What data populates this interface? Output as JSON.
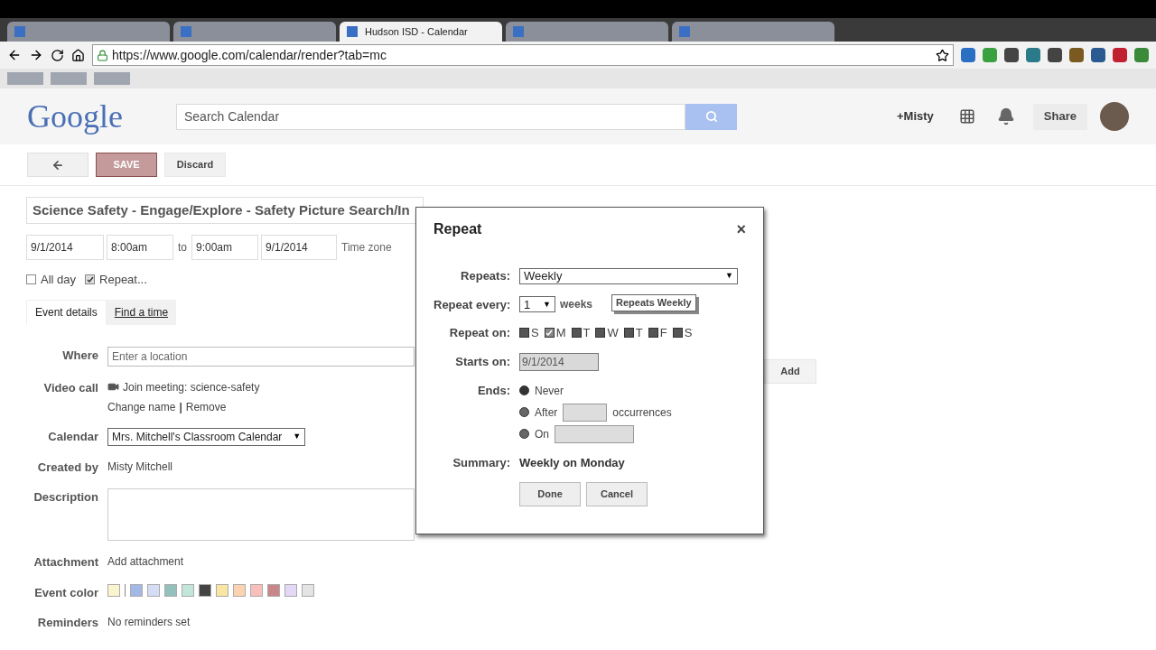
{
  "browser": {
    "tabs": [
      {
        "selected": false
      },
      {
        "selected": false
      },
      {
        "label": "Hudson ISD - Calendar",
        "selected": true
      },
      {
        "selected": false
      },
      {
        "selected": false
      }
    ],
    "url": "https://www.google.com/calendar/render?tab=mc"
  },
  "header": {
    "logo": "Google",
    "search_placeholder": "Search Calendar",
    "user": "+Misty",
    "share": "Share"
  },
  "toolbar": {
    "save": "SAVE",
    "discard": "Discard"
  },
  "event": {
    "title": "Science Safety - Engage/Explore - Safety Picture Search/In",
    "start_date": "9/1/2014",
    "start_time": "8:00am",
    "to": "to",
    "end_time": "9:00am",
    "end_date": "9/1/2014",
    "time_zone": "Time zone",
    "all_day": {
      "label": "All day",
      "checked": false
    },
    "repeat": {
      "label": "Repeat...",
      "checked": true
    }
  },
  "tabs": [
    {
      "label": "Event details",
      "selected": true
    },
    {
      "label": "Find a time",
      "selected": false
    }
  ],
  "fields": [
    {
      "kind": "input",
      "label": "Where",
      "placeholder": "Enter a location"
    },
    {
      "kind": "video",
      "label": "Video call",
      "join": "Join meeting: science-safety",
      "change": "Change name",
      "sep": "|",
      "remove": "Remove"
    },
    {
      "kind": "select",
      "label": "Calendar",
      "value": "Mrs. Mitchell's Classroom Calendar"
    },
    {
      "kind": "text",
      "label": "Created by",
      "value": "Misty Mitchell"
    },
    {
      "kind": "textarea",
      "label": "Description"
    },
    {
      "kind": "text",
      "label": "Attachment",
      "value": "Add attachment"
    },
    {
      "kind": "colors",
      "label": "Event color"
    },
    {
      "kind": "text",
      "label": "Reminders",
      "value": "No reminders set"
    }
  ],
  "event_colors": [
    {
      "color": "#fbf5cf"
    },
    {
      "color": "#a4b8e6"
    },
    {
      "color": "#d5ddf5"
    },
    {
      "color": "#93c0bb"
    },
    {
      "color": "#c2e6da"
    },
    {
      "color": "#444444"
    },
    {
      "color": "#f8e6a2"
    },
    {
      "color": "#fbd3b0"
    },
    {
      "color": "#f9c0bb"
    },
    {
      "color": "#c8858a"
    },
    {
      "color": "#e4d8f7"
    },
    {
      "color": "#e4e4e4"
    }
  ],
  "add_button": "Add",
  "caret": "▼",
  "dialog": {
    "title": "Repeat",
    "close": "×",
    "repeats_label": "Repeats:",
    "repeats_value": "Weekly",
    "every_label": "Repeat every:",
    "every_value": "1",
    "every_unit": "weeks",
    "tooltip": "Repeats Weekly",
    "on_label": "Repeat on:",
    "days": [
      {
        "label": "S",
        "checked": false
      },
      {
        "label": "M",
        "checked": true
      },
      {
        "label": "T",
        "checked": false
      },
      {
        "label": "W",
        "checked": false
      },
      {
        "label": "T",
        "checked": false
      },
      {
        "label": "F",
        "checked": false
      },
      {
        "label": "S",
        "checked": false
      }
    ],
    "starts_label": "Starts on:",
    "starts_value": "9/1/2014",
    "ends_label": "Ends:",
    "ends": [
      {
        "kind": "plain",
        "label": "Never",
        "selected": true
      },
      {
        "kind": "count",
        "label": "After",
        "suffix": "occurrences",
        "selected": false
      },
      {
        "kind": "date",
        "label": "On",
        "selected": false
      }
    ],
    "summary_label": "Summary:",
    "summary": "Weekly on Monday",
    "done": "Done",
    "cancel": "Cancel"
  }
}
